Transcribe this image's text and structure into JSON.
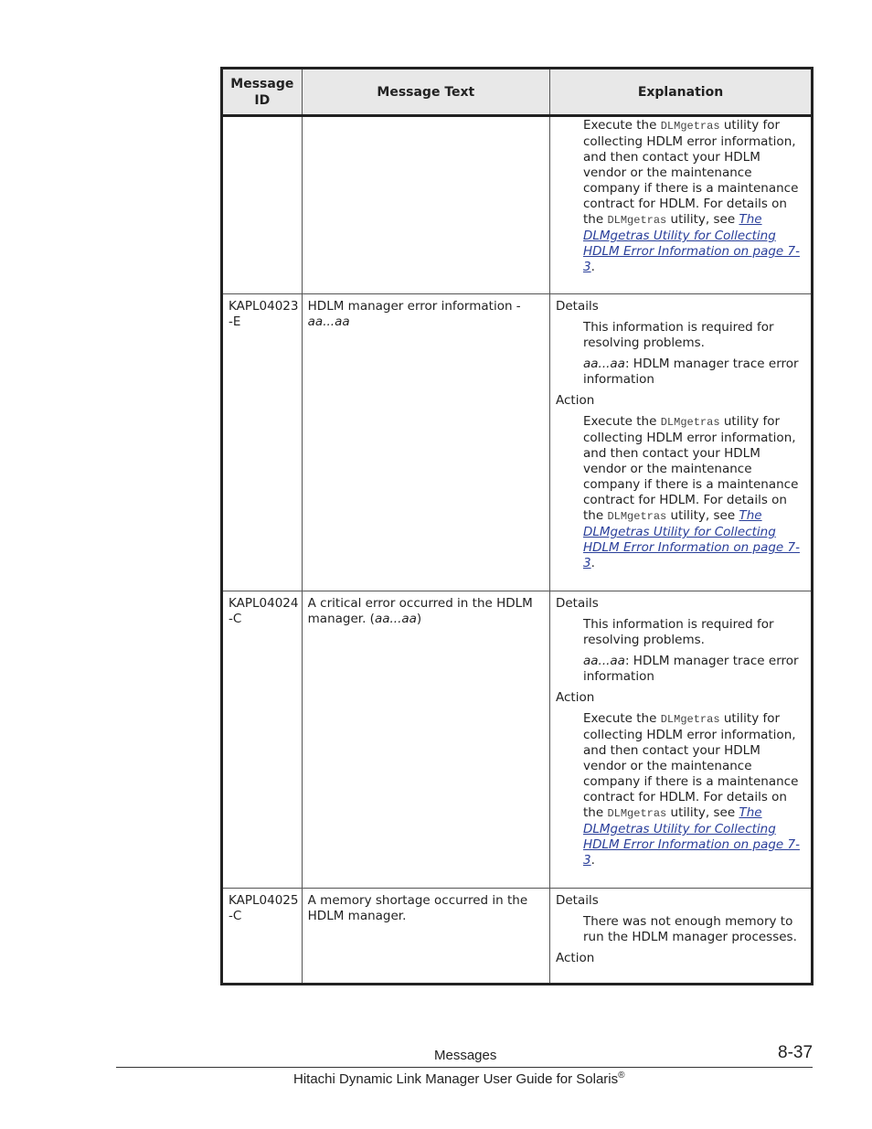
{
  "table": {
    "headers": [
      "Message ID",
      "Message Text",
      "Explanation"
    ],
    "rows": [
      {
        "id": "",
        "text": "",
        "text_var": "",
        "text_suffix": "",
        "details_label": "",
        "details": [],
        "action_label": "",
        "action": {
          "pre": "Execute the ",
          "code1": "DLMgetras",
          "mid": " utility for collecting HDLM error information, and then contact your HDLM vendor or the maintenance company if there is a maintenance contract for HDLM. For details on the ",
          "code2": "DLMgetras",
          "post": " utility, see ",
          "link": "The DLMgetras Utility for Collecting HDLM Error Information on page 7-3",
          "end": "."
        }
      },
      {
        "id": "KAPL04023 -E",
        "text": "HDLM manager error information - ",
        "text_var": "aa...aa",
        "text_suffix": "",
        "details_label": "Details",
        "details": [
          {
            "var": "",
            "text": "This information is required for resolving problems."
          },
          {
            "var": "aa...aa",
            "text": ": HDLM manager trace error information"
          }
        ],
        "action_label": "Action",
        "action": {
          "pre": "Execute the ",
          "code1": "DLMgetras",
          "mid": " utility for collecting HDLM error information, and then contact your HDLM vendor or the maintenance company if there is a maintenance contract for HDLM. For details on the ",
          "code2": "DLMgetras",
          "post": " utility, see ",
          "link": "The DLMgetras Utility for Collecting HDLM Error Information on page 7-3",
          "end": "."
        }
      },
      {
        "id": "KAPL04024 -C",
        "text": "A critical error occurred in the HDLM manager. (",
        "text_var": "aa...aa",
        "text_suffix": ")",
        "details_label": "Details",
        "details": [
          {
            "var": "",
            "text": "This information is required for resolving problems."
          },
          {
            "var": "aa...aa",
            "text": ": HDLM manager trace error information"
          }
        ],
        "action_label": "Action",
        "action": {
          "pre": "Execute the ",
          "code1": "DLMgetras",
          "mid": " utility for collecting HDLM error information, and then contact your HDLM vendor or the maintenance company if there is a maintenance contract for HDLM. For details on the ",
          "code2": "DLMgetras",
          "post": " utility, see ",
          "link": "The DLMgetras Utility for Collecting HDLM Error Information on page 7-3",
          "end": "."
        }
      },
      {
        "id": "KAPL04025 -C",
        "text": "A memory shortage occurred in the HDLM manager.",
        "text_var": "",
        "text_suffix": "",
        "details_label": "Details",
        "details": [
          {
            "var": "",
            "text": "There was not enough memory to run the HDLM manager processes."
          }
        ],
        "action_label": "Action",
        "action": null
      }
    ]
  },
  "footer": {
    "section": "Messages",
    "page": "8-37",
    "title": "Hitachi Dynamic Link Manager User Guide for Solaris",
    "title_mark": "®"
  }
}
